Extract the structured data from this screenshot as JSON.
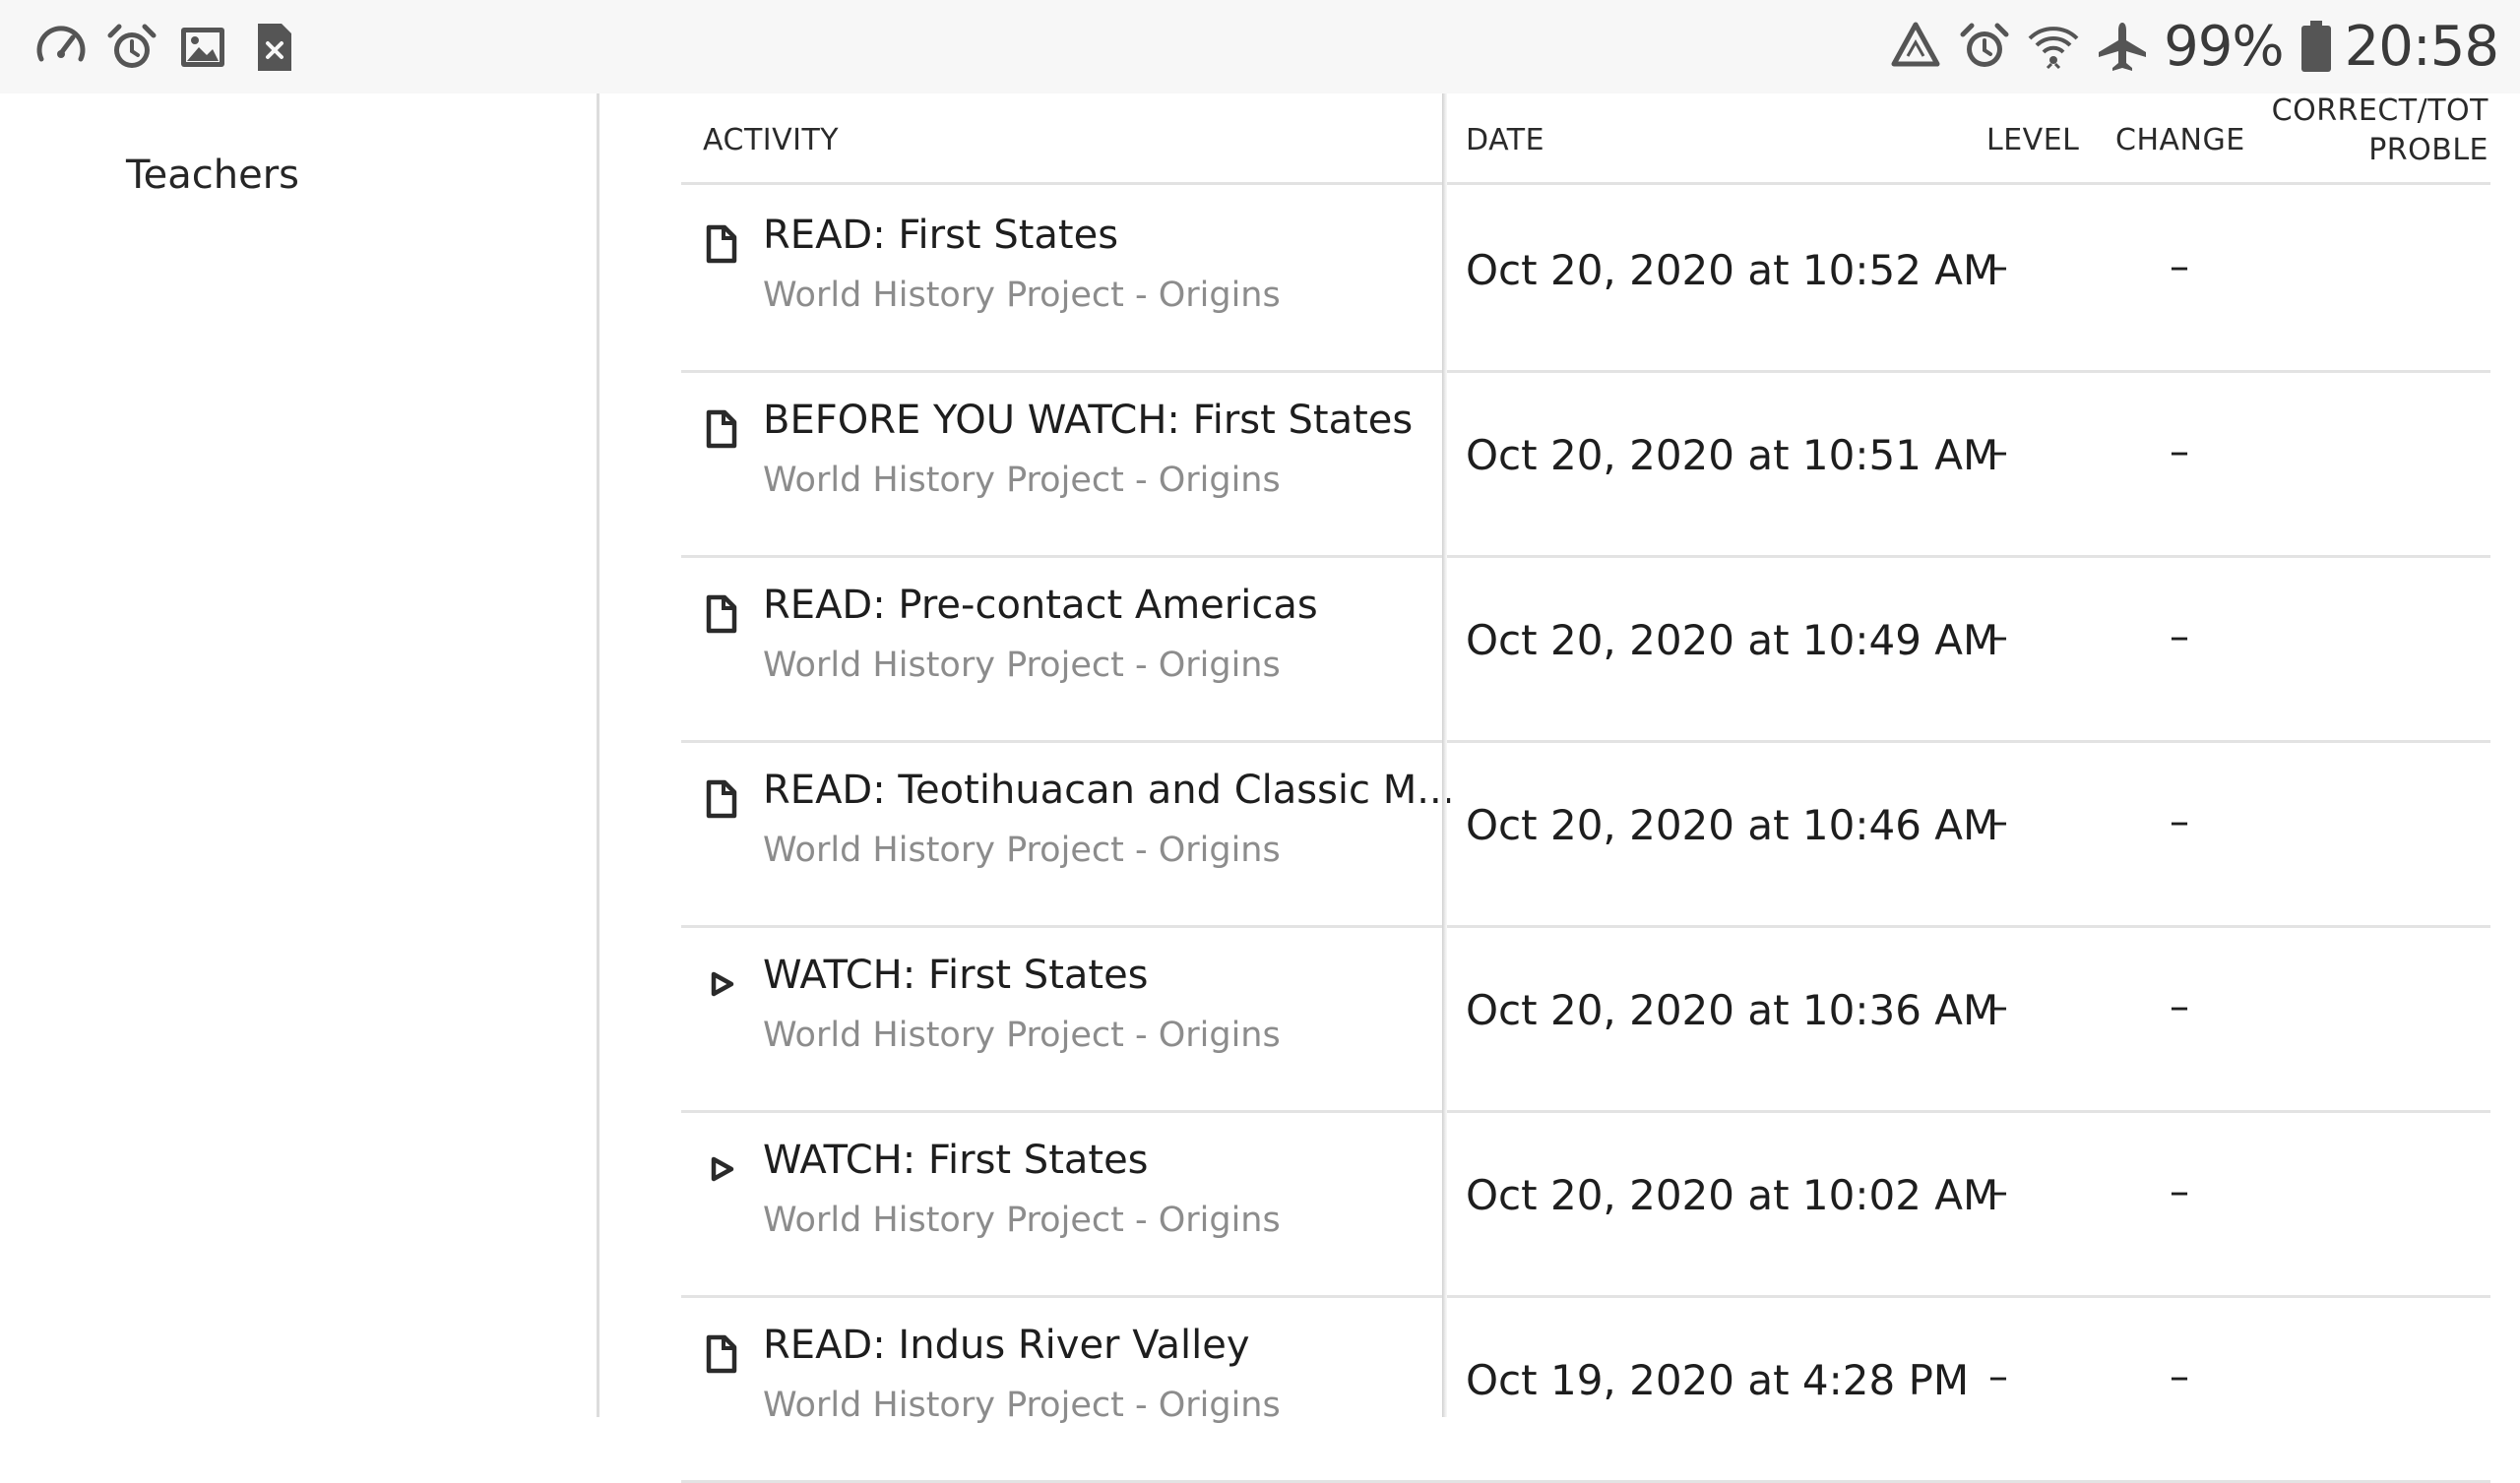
{
  "status_bar": {
    "left_icons": [
      "speedometer-icon",
      "alarm-icon",
      "image-icon",
      "sim-error-icon"
    ],
    "right_icons": [
      "recycle-warning-icon",
      "alarm-icon",
      "wifi-icon",
      "airplane-mode-icon",
      "battery-icon"
    ],
    "battery_percent": "99%",
    "time": "20:58"
  },
  "sidebar": {
    "items": [
      {
        "label": "Teachers"
      }
    ]
  },
  "table": {
    "columns": {
      "activity": "ACTIVITY",
      "date": "DATE",
      "level": "LEVEL",
      "change": "CHANGE",
      "correct_line1": "CORRECT/TOT",
      "correct_line2": "PROBLE"
    },
    "rows": [
      {
        "icon": "document-icon",
        "title": "READ: First States",
        "subtitle": "World History Project - Origins",
        "date": "Oct 20, 2020 at 10:52 AM",
        "level": "–",
        "change": "–"
      },
      {
        "icon": "document-icon",
        "title": "BEFORE YOU WATCH: First States",
        "subtitle": "World History Project - Origins",
        "date": "Oct 20, 2020 at 10:51 AM",
        "level": "–",
        "change": "–"
      },
      {
        "icon": "document-icon",
        "title": "READ: Pre-contact Americas",
        "subtitle": "World History Project - Origins",
        "date": "Oct 20, 2020 at 10:49 AM",
        "level": "–",
        "change": "–"
      },
      {
        "icon": "document-icon",
        "title": "READ: Teotihuacan and Classic M...",
        "subtitle": "World History Project - Origins",
        "date": "Oct 20, 2020 at 10:46 AM",
        "level": "–",
        "change": "–"
      },
      {
        "icon": "play-icon",
        "title": "WATCH: First States",
        "subtitle": "World History Project - Origins",
        "date": "Oct 20, 2020 at 10:36 AM",
        "level": "–",
        "change": "–"
      },
      {
        "icon": "play-icon",
        "title": "WATCH: First States",
        "subtitle": "World History Project - Origins",
        "date": "Oct 20, 2020 at 10:02 AM",
        "level": "–",
        "change": "–"
      },
      {
        "icon": "document-icon",
        "title": "READ: Indus River Valley",
        "subtitle": "World History Project - Origins",
        "date": "Oct 19, 2020 at 4:28 PM",
        "level": "–",
        "change": "–"
      }
    ]
  }
}
